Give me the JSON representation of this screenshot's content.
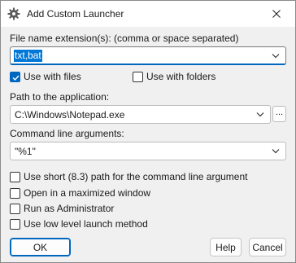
{
  "window": {
    "title": "Add Custom Launcher",
    "icon": "gear-icon"
  },
  "extensions": {
    "label": "File name extension(s): (comma or space separated)",
    "value": "txt,bat"
  },
  "use_with_files": {
    "label": "Use with files",
    "checked": true
  },
  "use_with_folders": {
    "label": "Use with folders",
    "checked": false
  },
  "path": {
    "label": "Path to the application:",
    "value": "C:\\Windows\\Notepad.exe",
    "browse_label": "..."
  },
  "args": {
    "label": "Command line arguments:",
    "value": "\"%1\""
  },
  "options": [
    {
      "label": "Use short (8.3) path for the command line argument",
      "checked": false
    },
    {
      "label": "Open in a maximized window",
      "checked": false
    },
    {
      "label": "Run as Administrator",
      "checked": false
    },
    {
      "label": "Use low level launch method",
      "checked": false
    }
  ],
  "buttons": {
    "ok": "OK",
    "help": "Help",
    "cancel": "Cancel"
  },
  "colors": {
    "accent": "#0067c0",
    "selection": "#0078d7"
  }
}
